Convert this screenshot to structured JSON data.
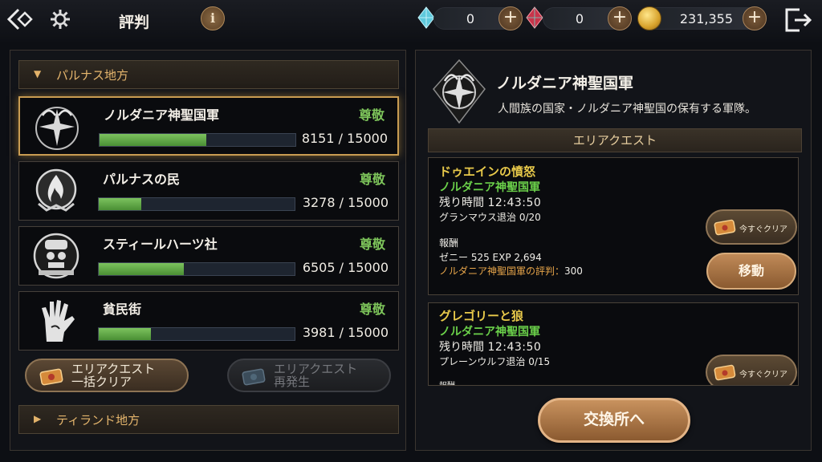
{
  "header": {
    "title": "評判",
    "info_label": "i",
    "currencies": [
      {
        "name": "cyan-crystal",
        "value": "0",
        "color": "#6fd3e6"
      },
      {
        "name": "red-crystal",
        "value": "0",
        "color": "#c9344a"
      },
      {
        "name": "zeny-coin",
        "value": "231,355",
        "color": "#e0b13a"
      }
    ],
    "plus_label": "+"
  },
  "left": {
    "region_open": "パルナス地方",
    "region_closed": "ティランド地方",
    "factions": [
      {
        "name": "ノルダニア神聖国軍",
        "rank": "尊敬",
        "current": 8151,
        "max": 15000,
        "score": "8151 / 15000",
        "emblem": "winged-cross-emblem-icon"
      },
      {
        "name": "パルナスの民",
        "rank": "尊敬",
        "current": 3278,
        "max": 15000,
        "score": "3278 / 15000",
        "emblem": "flame-emblem-icon"
      },
      {
        "name": "スティールハーツ社",
        "rank": "尊敬",
        "current": 6505,
        "max": 15000,
        "score": "6505 / 15000",
        "emblem": "skull-mask-emblem-icon"
      },
      {
        "name": "貧民街",
        "rank": "尊敬",
        "current": 3981,
        "max": 15000,
        "score": "3981 / 15000",
        "emblem": "hand-emblem-icon"
      }
    ],
    "bulk_clear": {
      "line1": "エリアクエスト",
      "line2": "一括クリア"
    },
    "regenerate": {
      "line1": "エリアクエスト",
      "line2": "再発生"
    }
  },
  "right": {
    "faction_name": "ノルダニア神聖国軍",
    "faction_desc": "人間族の国家・ノルダニア神聖国の保有する軍隊。",
    "area_quest_header": "エリアクエスト",
    "quests": [
      {
        "title": "ドゥエインの憤怒",
        "faction": "ノルダニア神聖国軍",
        "time_label": "残り時間",
        "time": "12:43:50",
        "task": "グランマウス退治 0/20",
        "reward_label": "報酬",
        "reward": "ゼニー 525 EXP 2,694",
        "rep": "ノルダニア神聖国軍の評判：",
        "rep_value": "300",
        "clear_label": "今すぐクリア",
        "move_label": "移動"
      },
      {
        "title": "グレゴリーと狼",
        "faction": "ノルダニア神聖国軍",
        "time_label": "残り時間",
        "time": "12:43:50",
        "task": "プレーンウルフ退治 0/15",
        "reward_label": "報酬",
        "clear_label": "今すぐクリア"
      }
    ],
    "exchange_label": "交換所へ"
  }
}
